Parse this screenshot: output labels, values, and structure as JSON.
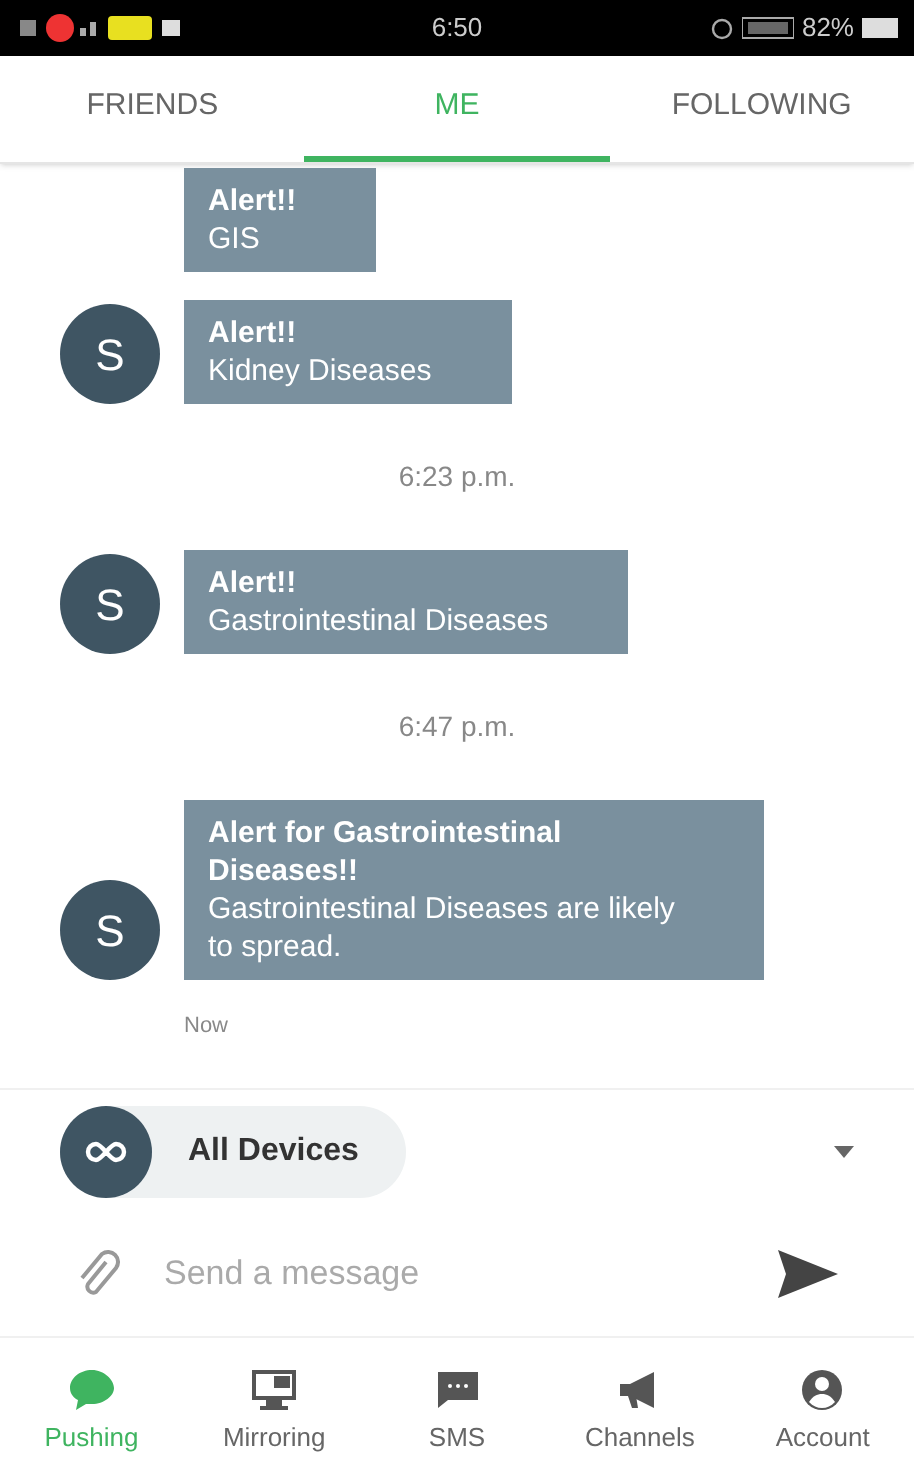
{
  "status_bar": {
    "time": "6:50",
    "battery": "82%"
  },
  "tabs": [
    {
      "label": "FRIENDS",
      "selected": false
    },
    {
      "label": "ME",
      "selected": true
    },
    {
      "label": "FOLLOWING",
      "selected": false
    }
  ],
  "chat": [
    {
      "kind": "message",
      "title": "Alert!!",
      "body": "GIS"
    },
    {
      "kind": "message",
      "avatar": "S",
      "title": "Alert!!",
      "body": "Kidney Diseases"
    },
    {
      "kind": "time",
      "text": "6:23 p.m."
    },
    {
      "kind": "message",
      "avatar": "S",
      "title": "Alert!!",
      "body": "Gastrointestinal Diseases"
    },
    {
      "kind": "time",
      "text": "6:47 p.m."
    },
    {
      "kind": "message",
      "avatar": "S",
      "title": "Alert for Gastrointestinal Diseases!!",
      "body": "Gastrointestinal Diseases are likely to spread."
    },
    {
      "kind": "stamp",
      "text": "Now"
    }
  ],
  "device_picker": {
    "label": "All Devices"
  },
  "composer": {
    "placeholder": "Send a message"
  },
  "bottom_nav": [
    {
      "label": "Pushing",
      "selected": true
    },
    {
      "label": "Mirroring",
      "selected": false
    },
    {
      "label": "SMS",
      "selected": false
    },
    {
      "label": "Channels",
      "selected": false
    },
    {
      "label": "Account",
      "selected": false
    }
  ]
}
